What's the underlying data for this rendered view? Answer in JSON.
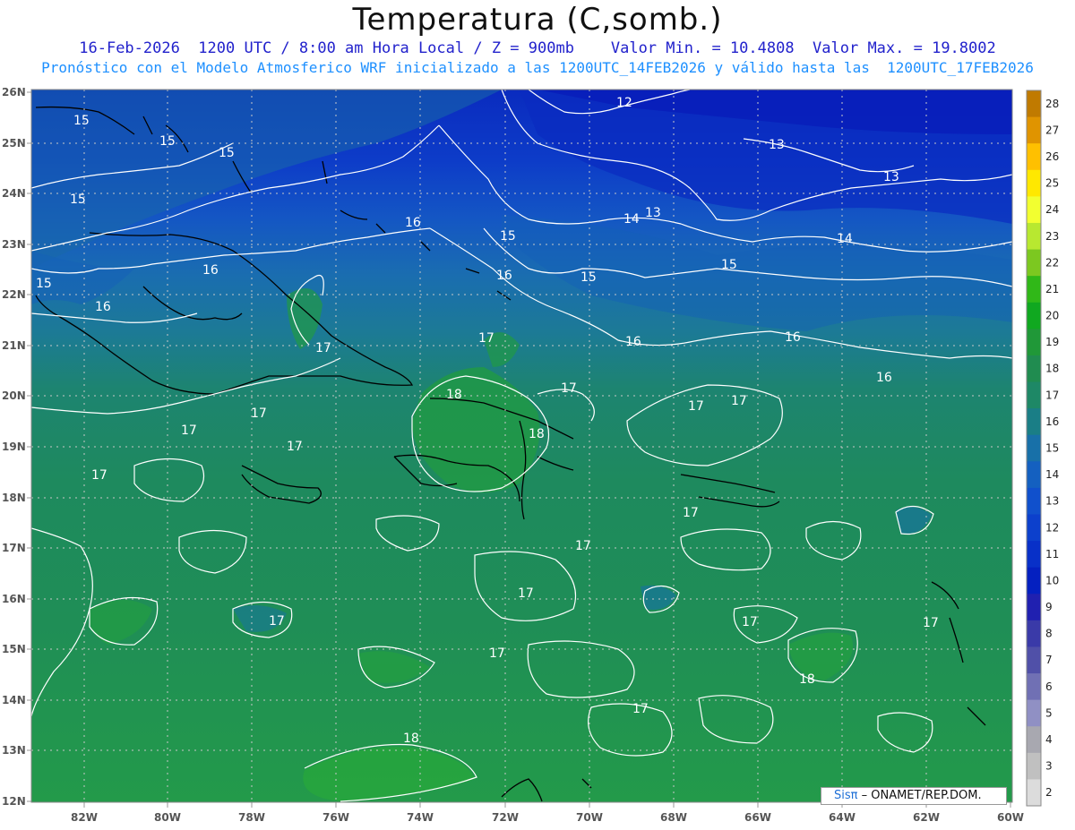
{
  "header": {
    "title": "Temperatura (C,somb.)",
    "line1": "16-Feb-2026  1200 UTC / 8:00 am Hora Local / Z = 900mb    Valor Min. = 10.4808  Valor Max. = 19.8002",
    "line2": "Pronóstico con el Modelo Atmosferico WRF inicializado a las 1200UTC_14FEB2026 y válido hasta las  1200UTC_17FEB2026"
  },
  "map": {
    "lat_labels": [
      "26N",
      "25N",
      "24N",
      "23N",
      "22N",
      "21N",
      "20N",
      "19N",
      "18N",
      "17N",
      "16N",
      "15N",
      "14N",
      "13N",
      "12N"
    ],
    "lon_labels": [
      "82W",
      "80W",
      "78W",
      "76W",
      "74W",
      "72W",
      "70W",
      "68W",
      "66W",
      "64W",
      "62W",
      "60W"
    ],
    "contour_labels": [
      {
        "text": "12"
      },
      {
        "text": "13"
      },
      {
        "text": "13"
      },
      {
        "text": "13"
      },
      {
        "text": "14"
      },
      {
        "text": "14"
      },
      {
        "text": "15"
      },
      {
        "text": "15"
      },
      {
        "text": "15"
      },
      {
        "text": "15"
      },
      {
        "text": "15"
      },
      {
        "text": "15"
      },
      {
        "text": "15"
      },
      {
        "text": "15"
      },
      {
        "text": "16"
      },
      {
        "text": "16"
      },
      {
        "text": "16"
      },
      {
        "text": "16"
      },
      {
        "text": "16"
      },
      {
        "text": "16"
      },
      {
        "text": "16"
      },
      {
        "text": "17"
      },
      {
        "text": "17"
      },
      {
        "text": "17"
      },
      {
        "text": "17"
      },
      {
        "text": "17"
      },
      {
        "text": "17"
      },
      {
        "text": "17"
      },
      {
        "text": "17"
      },
      {
        "text": "17"
      },
      {
        "text": "17"
      },
      {
        "text": "17"
      },
      {
        "text": "17"
      },
      {
        "text": "17"
      },
      {
        "text": "17"
      },
      {
        "text": "17"
      },
      {
        "text": "17"
      },
      {
        "text": "17"
      },
      {
        "text": "18"
      },
      {
        "text": "18"
      },
      {
        "text": "18"
      },
      {
        "text": "18"
      }
    ]
  },
  "colorbar": {
    "levels": [
      "28",
      "27",
      "26",
      "25",
      "24",
      "23",
      "22",
      "21",
      "20",
      "19",
      "18",
      "17",
      "16",
      "15",
      "14",
      "13",
      "12",
      "11",
      "10",
      "9",
      "8",
      "7",
      "6",
      "5",
      "4",
      "3",
      "2"
    ],
    "colors": [
      "#c07a00",
      "#e09400",
      "#ffc000",
      "#ffe800",
      "#f2ff30",
      "#b8e830",
      "#7cc820",
      "#30b818",
      "#10a820",
      "#209838",
      "#208c50",
      "#1e8866",
      "#1a7e86",
      "#1870a8",
      "#1460c0",
      "#1050cc",
      "#0c40cc",
      "#0830c8",
      "#0420c0",
      "#2020b0",
      "#3a3aa8",
      "#5050a8",
      "#7070b4",
      "#9090c4",
      "#a8a8b0",
      "#c0c0c0",
      "#dcdcdc"
    ]
  },
  "credit": {
    "brand": "Sisπ",
    "text": " – ONAMET/REP.DOM."
  }
}
